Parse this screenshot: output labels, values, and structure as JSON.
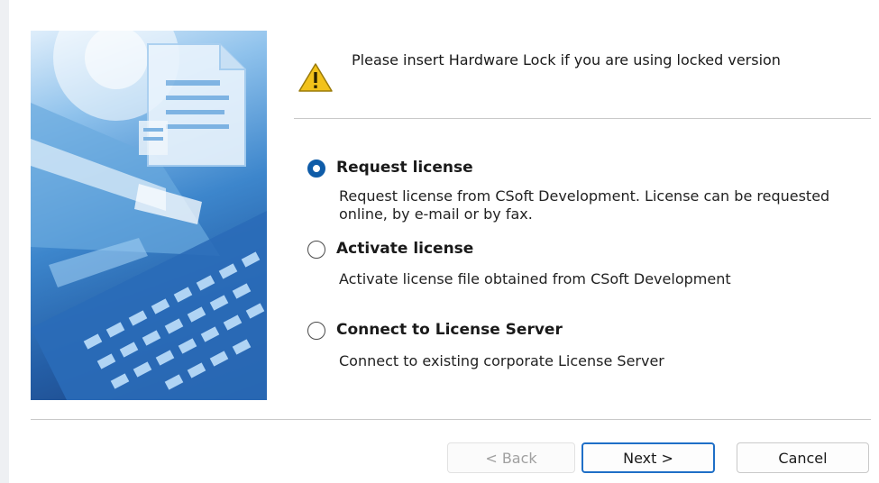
{
  "notice": {
    "icon": "warning-icon",
    "text": "Please insert Hardware Lock if you are using locked version"
  },
  "options": [
    {
      "title": "Request license",
      "description": "Request license from CSoft Development. License can be requested online, by e-mail or by fax.",
      "selected": true
    },
    {
      "title": "Activate license",
      "description": "Activate license file obtained from CSoft Development",
      "selected": false
    },
    {
      "title": "Connect to License Server",
      "description": "Connect to existing corporate License Server",
      "selected": false
    }
  ],
  "buttons": {
    "back": "< Back",
    "next": "Next >",
    "cancel": "Cancel"
  },
  "colors": {
    "accent": "#1f6fc7",
    "radio_selected": "#0f5ca8",
    "warning": "#f2c21b"
  }
}
